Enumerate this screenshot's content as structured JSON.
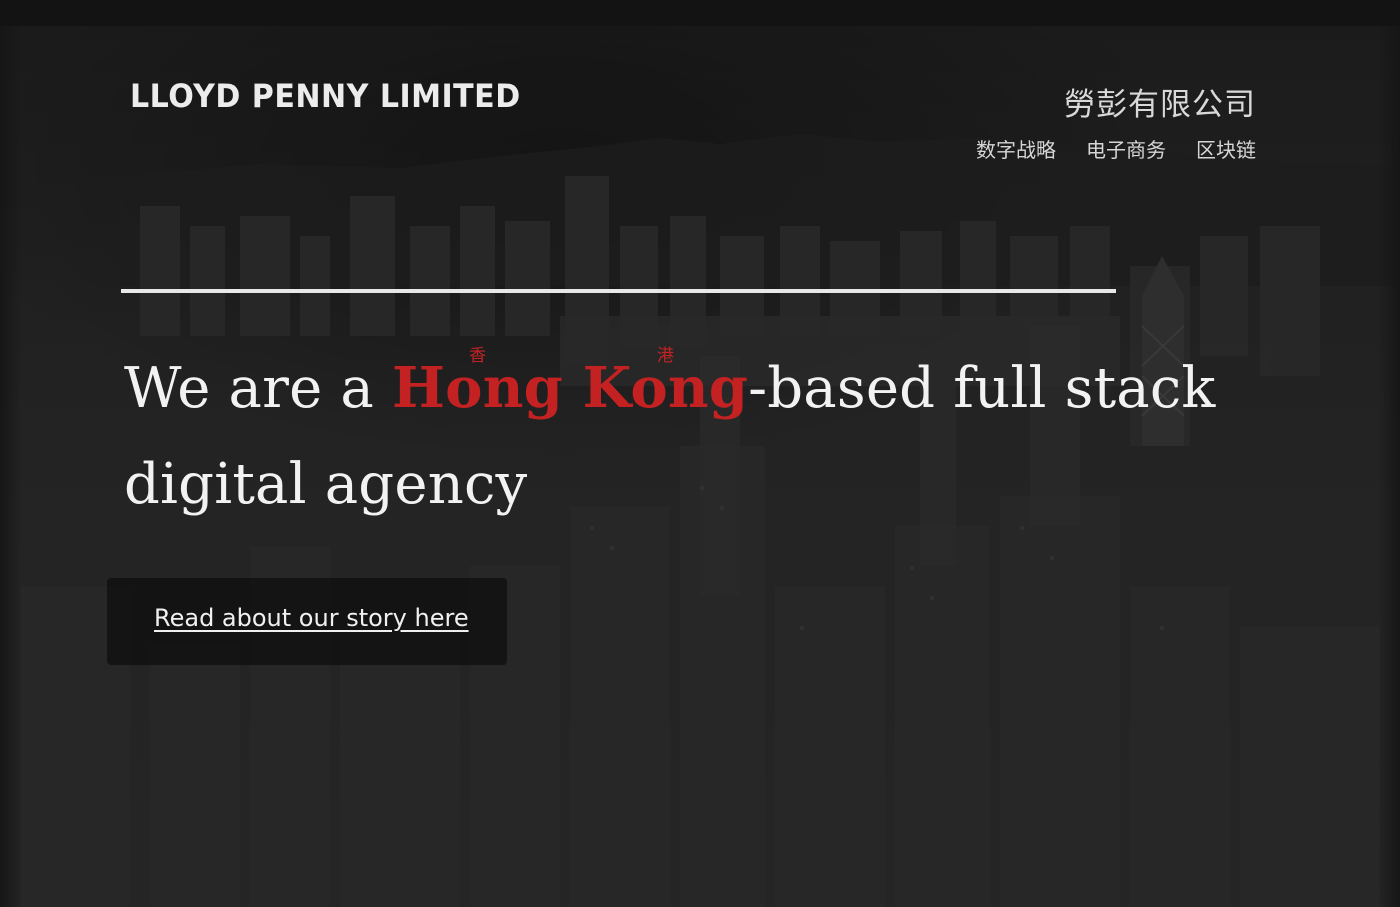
{
  "header": {
    "brand": "LLOYD PENNY LIMITED",
    "chinese_name": "勞彭有限公司"
  },
  "nav": {
    "items": [
      {
        "label": "数字战略"
      },
      {
        "label": "电子商务"
      },
      {
        "label": "区块链"
      }
    ]
  },
  "hero": {
    "headline_prefix": "We are a ",
    "highlight_word_1": "Hong",
    "highlight_word_1_annotation": "香",
    "highlight_word_2": "Kong",
    "highlight_word_2_annotation": "港",
    "headline_line1_suffix": "-based full stack",
    "headline_line2": "digital agency",
    "cta_label": "Read about our story here"
  },
  "colors": {
    "accent_red": "#c42222",
    "background": "#262626",
    "text": "#f2f2f2"
  }
}
